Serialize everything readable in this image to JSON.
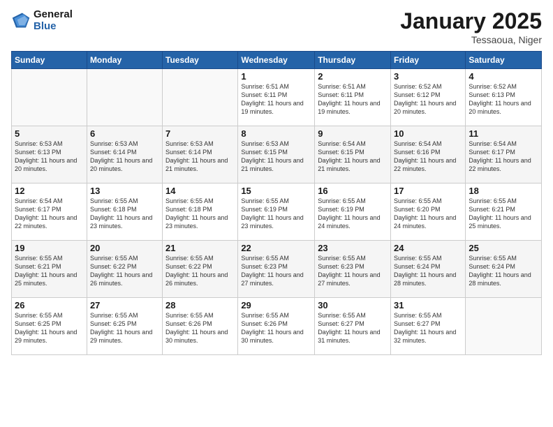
{
  "header": {
    "logo_line1": "General",
    "logo_line2": "Blue",
    "month": "January 2025",
    "location": "Tessaoua, Niger"
  },
  "weekdays": [
    "Sunday",
    "Monday",
    "Tuesday",
    "Wednesday",
    "Thursday",
    "Friday",
    "Saturday"
  ],
  "weeks": [
    [
      {
        "day": "",
        "info": ""
      },
      {
        "day": "",
        "info": ""
      },
      {
        "day": "",
        "info": ""
      },
      {
        "day": "1",
        "info": "Sunrise: 6:51 AM\nSunset: 6:11 PM\nDaylight: 11 hours and 19 minutes."
      },
      {
        "day": "2",
        "info": "Sunrise: 6:51 AM\nSunset: 6:11 PM\nDaylight: 11 hours and 19 minutes."
      },
      {
        "day": "3",
        "info": "Sunrise: 6:52 AM\nSunset: 6:12 PM\nDaylight: 11 hours and 20 minutes."
      },
      {
        "day": "4",
        "info": "Sunrise: 6:52 AM\nSunset: 6:13 PM\nDaylight: 11 hours and 20 minutes."
      }
    ],
    [
      {
        "day": "5",
        "info": "Sunrise: 6:53 AM\nSunset: 6:13 PM\nDaylight: 11 hours and 20 minutes."
      },
      {
        "day": "6",
        "info": "Sunrise: 6:53 AM\nSunset: 6:14 PM\nDaylight: 11 hours and 20 minutes."
      },
      {
        "day": "7",
        "info": "Sunrise: 6:53 AM\nSunset: 6:14 PM\nDaylight: 11 hours and 21 minutes."
      },
      {
        "day": "8",
        "info": "Sunrise: 6:53 AM\nSunset: 6:15 PM\nDaylight: 11 hours and 21 minutes."
      },
      {
        "day": "9",
        "info": "Sunrise: 6:54 AM\nSunset: 6:15 PM\nDaylight: 11 hours and 21 minutes."
      },
      {
        "day": "10",
        "info": "Sunrise: 6:54 AM\nSunset: 6:16 PM\nDaylight: 11 hours and 22 minutes."
      },
      {
        "day": "11",
        "info": "Sunrise: 6:54 AM\nSunset: 6:17 PM\nDaylight: 11 hours and 22 minutes."
      }
    ],
    [
      {
        "day": "12",
        "info": "Sunrise: 6:54 AM\nSunset: 6:17 PM\nDaylight: 11 hours and 22 minutes."
      },
      {
        "day": "13",
        "info": "Sunrise: 6:55 AM\nSunset: 6:18 PM\nDaylight: 11 hours and 23 minutes."
      },
      {
        "day": "14",
        "info": "Sunrise: 6:55 AM\nSunset: 6:18 PM\nDaylight: 11 hours and 23 minutes."
      },
      {
        "day": "15",
        "info": "Sunrise: 6:55 AM\nSunset: 6:19 PM\nDaylight: 11 hours and 23 minutes."
      },
      {
        "day": "16",
        "info": "Sunrise: 6:55 AM\nSunset: 6:19 PM\nDaylight: 11 hours and 24 minutes."
      },
      {
        "day": "17",
        "info": "Sunrise: 6:55 AM\nSunset: 6:20 PM\nDaylight: 11 hours and 24 minutes."
      },
      {
        "day": "18",
        "info": "Sunrise: 6:55 AM\nSunset: 6:21 PM\nDaylight: 11 hours and 25 minutes."
      }
    ],
    [
      {
        "day": "19",
        "info": "Sunrise: 6:55 AM\nSunset: 6:21 PM\nDaylight: 11 hours and 25 minutes."
      },
      {
        "day": "20",
        "info": "Sunrise: 6:55 AM\nSunset: 6:22 PM\nDaylight: 11 hours and 26 minutes."
      },
      {
        "day": "21",
        "info": "Sunrise: 6:55 AM\nSunset: 6:22 PM\nDaylight: 11 hours and 26 minutes."
      },
      {
        "day": "22",
        "info": "Sunrise: 6:55 AM\nSunset: 6:23 PM\nDaylight: 11 hours and 27 minutes."
      },
      {
        "day": "23",
        "info": "Sunrise: 6:55 AM\nSunset: 6:23 PM\nDaylight: 11 hours and 27 minutes."
      },
      {
        "day": "24",
        "info": "Sunrise: 6:55 AM\nSunset: 6:24 PM\nDaylight: 11 hours and 28 minutes."
      },
      {
        "day": "25",
        "info": "Sunrise: 6:55 AM\nSunset: 6:24 PM\nDaylight: 11 hours and 28 minutes."
      }
    ],
    [
      {
        "day": "26",
        "info": "Sunrise: 6:55 AM\nSunset: 6:25 PM\nDaylight: 11 hours and 29 minutes."
      },
      {
        "day": "27",
        "info": "Sunrise: 6:55 AM\nSunset: 6:25 PM\nDaylight: 11 hours and 29 minutes."
      },
      {
        "day": "28",
        "info": "Sunrise: 6:55 AM\nSunset: 6:26 PM\nDaylight: 11 hours and 30 minutes."
      },
      {
        "day": "29",
        "info": "Sunrise: 6:55 AM\nSunset: 6:26 PM\nDaylight: 11 hours and 30 minutes."
      },
      {
        "day": "30",
        "info": "Sunrise: 6:55 AM\nSunset: 6:27 PM\nDaylight: 11 hours and 31 minutes."
      },
      {
        "day": "31",
        "info": "Sunrise: 6:55 AM\nSunset: 6:27 PM\nDaylight: 11 hours and 32 minutes."
      },
      {
        "day": "",
        "info": ""
      }
    ]
  ]
}
